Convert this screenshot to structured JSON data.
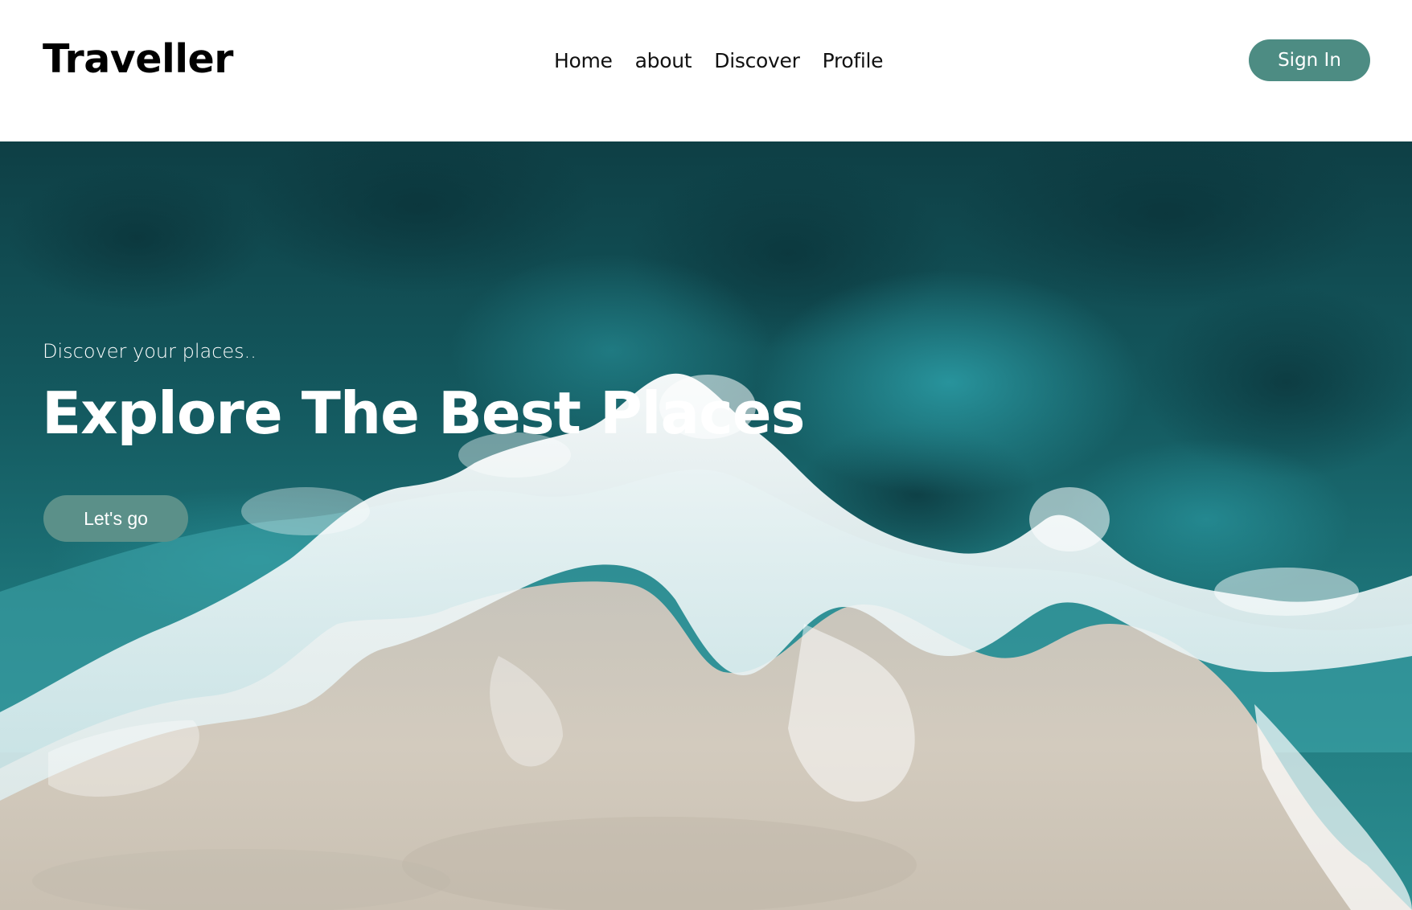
{
  "brand": {
    "name": "Traveller"
  },
  "nav": {
    "items": [
      {
        "label": "Home"
      },
      {
        "label": "about"
      },
      {
        "label": "Discover"
      },
      {
        "label": "Profile"
      }
    ]
  },
  "header": {
    "signin_label": "Sign In"
  },
  "hero": {
    "subtitle": "Discover your places..",
    "title": "Explore The Best Places",
    "cta_label": "Let's go"
  },
  "colors": {
    "accent": "#4d8c83",
    "cta": "#5b9089",
    "ocean_deep": "#0f4a4e",
    "ocean_mid": "#1e7a80",
    "foam": "#f2f5f6",
    "sand": "#cfc8bb"
  }
}
